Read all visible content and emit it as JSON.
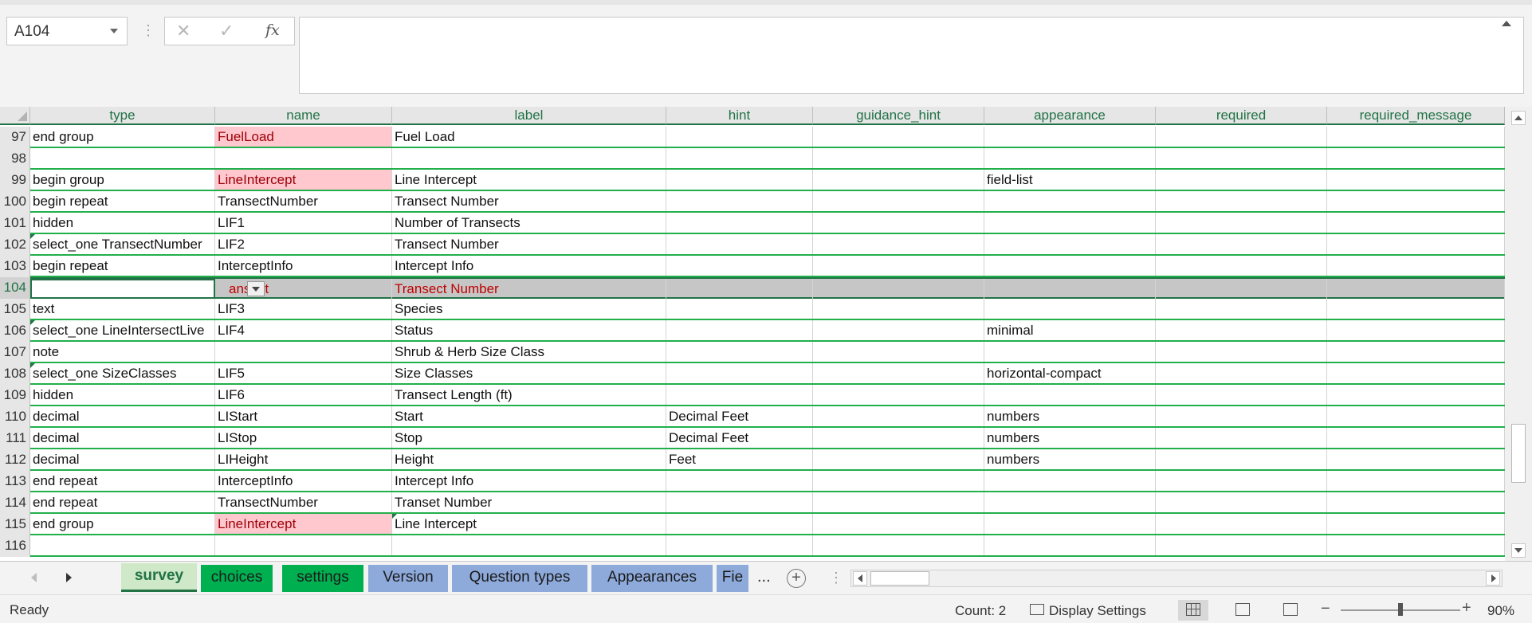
{
  "formula_bar": {
    "name_box": "A104",
    "cancel_glyph": "✕",
    "enter_glyph": "✓",
    "fx_label": "fx",
    "formula_value": ""
  },
  "columns": [
    "type",
    "name",
    "label",
    "hint",
    "guidance_hint",
    "appearance",
    "required",
    "required_message"
  ],
  "rows": [
    {
      "num": "97",
      "cells": [
        "end group",
        "FuelLoad",
        "Fuel Load",
        "",
        "",
        "",
        "",
        ""
      ]
    },
    {
      "num": "98",
      "cells": [
        "",
        "",
        "",
        "",
        "",
        "",
        "",
        ""
      ]
    },
    {
      "num": "99",
      "cells": [
        "begin group",
        "LineIntercept",
        "Line Intercept",
        "",
        "",
        "field-list",
        "",
        ""
      ]
    },
    {
      "num": "100",
      "cells": [
        "begin repeat",
        "TransectNumber",
        "Transect Number",
        "",
        "",
        "",
        "",
        ""
      ]
    },
    {
      "num": "101",
      "cells": [
        "hidden",
        "LIF1",
        "Number of Transects",
        "",
        "",
        "",
        "",
        ""
      ]
    },
    {
      "num": "102",
      "cells": [
        "select_one TransectNumber",
        "LIF2",
        "Transect Number",
        "",
        "",
        "",
        "",
        ""
      ]
    },
    {
      "num": "103",
      "cells": [
        "begin repeat",
        "InterceptInfo",
        "Intercept Info",
        "",
        "",
        "",
        "",
        ""
      ]
    },
    {
      "num": "104",
      "cells": [
        "",
        "ansect",
        "Transect Number",
        "",
        "",
        "",
        "",
        ""
      ]
    },
    {
      "num": "105",
      "cells": [
        "text",
        "LIF3",
        "Species",
        "",
        "",
        "",
        "",
        ""
      ]
    },
    {
      "num": "106",
      "cells": [
        "select_one LineIntersectLive",
        "LIF4",
        "Status",
        "",
        "",
        "minimal",
        "",
        ""
      ]
    },
    {
      "num": "107",
      "cells": [
        "note",
        "",
        "Shrub & Herb Size Class",
        "",
        "",
        "",
        "",
        ""
      ]
    },
    {
      "num": "108",
      "cells": [
        "select_one SizeClasses",
        "LIF5",
        "Size Classes",
        "",
        "",
        "horizontal-compact",
        "",
        ""
      ]
    },
    {
      "num": "109",
      "cells": [
        "hidden",
        "LIF6",
        "Transect Length (ft)",
        "",
        "",
        "",
        "",
        ""
      ]
    },
    {
      "num": "110",
      "cells": [
        "decimal",
        "LIStart",
        "Start",
        "Decimal Feet",
        "",
        "numbers",
        "",
        ""
      ]
    },
    {
      "num": "111",
      "cells": [
        "decimal",
        "LIStop",
        "Stop",
        "Decimal Feet",
        "",
        "numbers",
        "",
        ""
      ]
    },
    {
      "num": "112",
      "cells": [
        "decimal",
        "LIHeight",
        "Height",
        "Feet",
        "",
        "numbers",
        "",
        ""
      ]
    },
    {
      "num": "113",
      "cells": [
        "end repeat",
        "InterceptInfo",
        "Intercept Info",
        "",
        "",
        "",
        "",
        ""
      ]
    },
    {
      "num": "114",
      "cells": [
        "end repeat",
        "TransectNumber",
        "Transet Number",
        "",
        "",
        "",
        "",
        ""
      ]
    },
    {
      "num": "115",
      "cells": [
        "end group",
        "LineIntercept",
        "Line Intercept",
        "",
        "",
        "",
        "",
        ""
      ]
    },
    {
      "num": "116",
      "cells": [
        "",
        "",
        "",
        "",
        "",
        "",
        "",
        ""
      ]
    }
  ],
  "sheet_tabs": [
    {
      "label": "survey",
      "style": "active"
    },
    {
      "label": "choices",
      "style": "green"
    },
    {
      "label": "settings",
      "style": "green"
    },
    {
      "label": "Version",
      "style": "blue"
    },
    {
      "label": "Question types",
      "style": "blue"
    },
    {
      "label": "Appearances",
      "style": "blue"
    },
    {
      "label": "Fie",
      "style": "blue"
    }
  ],
  "tabs_ellipsis": "...",
  "add_sheet_glyph": "+",
  "status": {
    "ready": "Ready",
    "count": "Count: 2",
    "display_settings": "Display Settings",
    "zoom_minus": "−",
    "zoom_plus": "+",
    "zoom_level": "90%"
  },
  "icons": {
    "name_box_dropdown": "chevron-down-icon",
    "cancel": "close-icon",
    "enter": "check-icon",
    "function": "fx-icon",
    "collapse": "chevron-up-icon",
    "add_sheet": "plus-circle-icon",
    "display": "display-settings-icon",
    "normal_view": "grid-view-icon",
    "page_layout": "page-layout-icon",
    "page_break": "page-break-icon"
  },
  "colors": {
    "accent": "#217346",
    "row_border": "#21b04b",
    "pink_fill": "#ffc7ce",
    "pink_text": "#9c0006",
    "tab_green": "#00b050",
    "tab_blue": "#8eaadb"
  },
  "zoom_fraction": 0.5
}
